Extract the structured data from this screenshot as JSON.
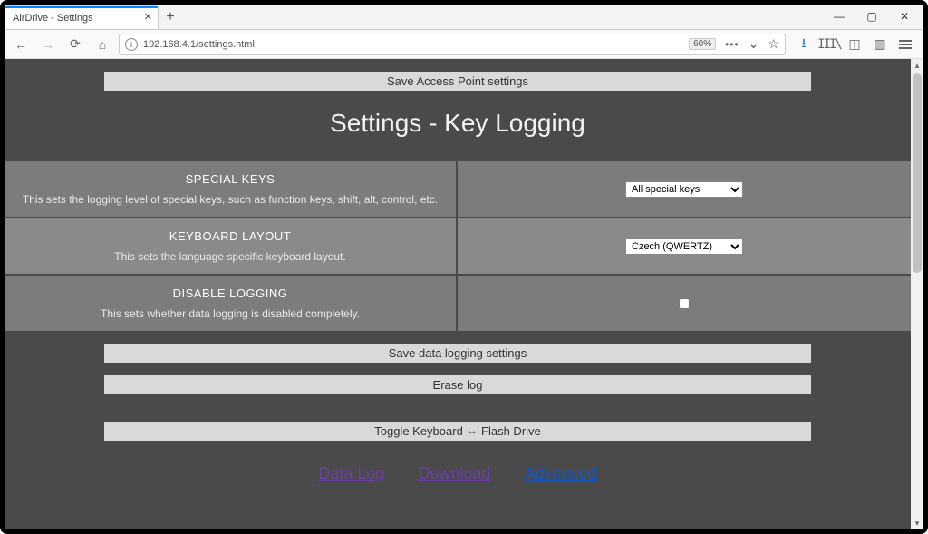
{
  "browser": {
    "tab_title": "AirDrive - Settings",
    "url": "192.168.4.1/settings.html",
    "zoom": "60%"
  },
  "page": {
    "save_ap_btn": "Save Access Point settings",
    "title": "Settings - Key Logging",
    "rows": {
      "special_keys": {
        "label": "SPECIAL KEYS",
        "desc": "This sets the logging level of special keys, such as function keys, shift, alt, control, etc.",
        "value": "All special keys"
      },
      "keyboard_layout": {
        "label": "KEYBOARD LAYOUT",
        "desc": "This sets the language specific keyboard layout.",
        "value": "Czech (QWERTZ)"
      },
      "disable_logging": {
        "label": "DISABLE LOGGING",
        "desc": "This sets whether data logging is disabled completely."
      }
    },
    "save_logging_btn": "Save data logging settings",
    "erase_btn": "Erase log",
    "toggle_btn": "Toggle Keyboard ⇔ Flash Drive",
    "links": {
      "data_log": "Data Log",
      "download": "Download",
      "advanced": "Advanced"
    }
  }
}
